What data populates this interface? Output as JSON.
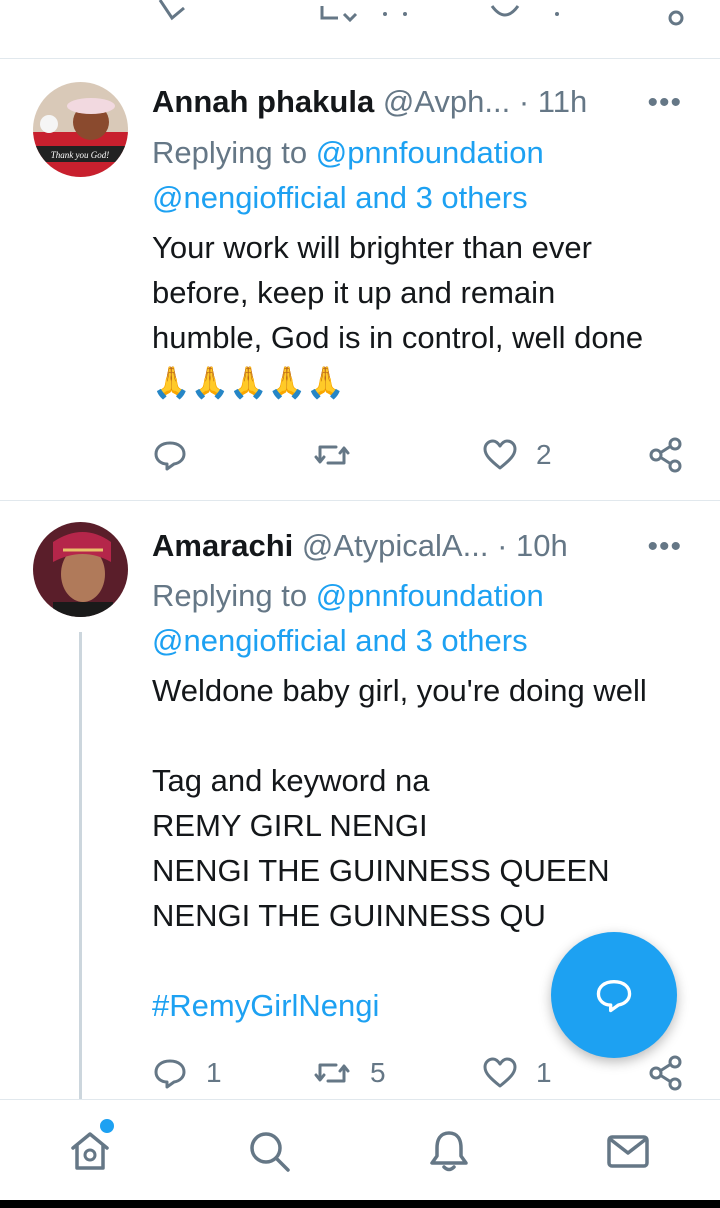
{
  "tweets": [
    {
      "name": "Annah phakula",
      "handle": "@Avph...",
      "time": "· 11h",
      "more": "•••",
      "replying_prefix": "Replying to",
      "replying_mentions_1": "@pnnfoundation",
      "replying_mentions_2": "@nengiofficial and 3 others",
      "text": "Your work will brighter than ever before, keep it up and remain humble, God is in control, well done 🙏🙏🙏🙏🙏",
      "avatar_caption": "Thank you God!",
      "reply_count": "",
      "retweet_count": "",
      "like_count": "2"
    },
    {
      "name": "Amarachi",
      "handle": "@AtypicalA...",
      "time": "· 10h",
      "more": "•••",
      "replying_prefix": "Replying to",
      "replying_mentions_1": "@pnnfoundation",
      "replying_mentions_2": "@nengiofficial and 3 others",
      "text": "Weldone baby girl, you're doing well\n\nTag and keyword na\nREMY GIRL NENGI\nNENGI THE GUINNESS QUEEN\nNENGI THE GUINNESS QU",
      "hashtag": "#RemyGirlNengi",
      "reply_count": "1",
      "retweet_count": "5",
      "like_count": "1"
    }
  ],
  "nav": [
    "home-icon",
    "search-icon",
    "bell-icon",
    "mail-icon"
  ],
  "colors": {
    "accent": "#1da1f2",
    "muted": "#657786",
    "text": "#14171a"
  }
}
